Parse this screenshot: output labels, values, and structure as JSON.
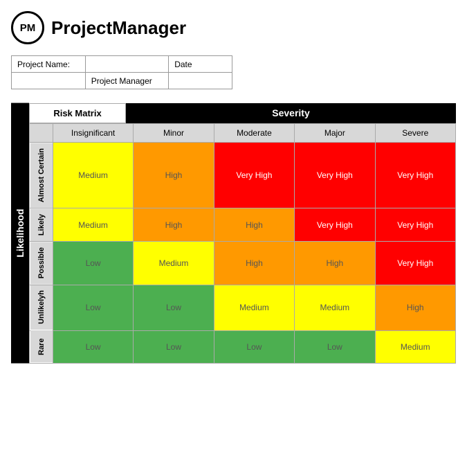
{
  "header": {
    "logo_text": "PM",
    "app_title": "ProjectManager"
  },
  "project_info": {
    "labels": [
      "Project Name:",
      "Project Manager",
      "Date"
    ],
    "values": [
      "",
      "",
      ""
    ]
  },
  "matrix": {
    "likelihood_label": "Likelihood",
    "severity_label": "Severity",
    "risk_matrix_label": "Risk Matrix",
    "col_headers": [
      "Insignificant",
      "Minor",
      "Moderate",
      "Major",
      "Severe"
    ],
    "rows": [
      {
        "label": "Almost Certain",
        "cells": [
          {
            "text": "Medium",
            "class": "medium"
          },
          {
            "text": "High",
            "class": "high"
          },
          {
            "text": "Very High",
            "class": "very-high"
          },
          {
            "text": "Very High",
            "class": "very-high"
          },
          {
            "text": "Very High",
            "class": "very-high"
          }
        ]
      },
      {
        "label": "Likely",
        "cells": [
          {
            "text": "Medium",
            "class": "medium"
          },
          {
            "text": "High",
            "class": "high"
          },
          {
            "text": "High",
            "class": "high"
          },
          {
            "text": "Very High",
            "class": "very-high"
          },
          {
            "text": "Very High",
            "class": "very-high"
          }
        ]
      },
      {
        "label": "Possible",
        "cells": [
          {
            "text": "Low",
            "class": "low"
          },
          {
            "text": "Medium",
            "class": "medium"
          },
          {
            "text": "High",
            "class": "high"
          },
          {
            "text": "High",
            "class": "high"
          },
          {
            "text": "Very High",
            "class": "very-high"
          }
        ]
      },
      {
        "label": "Unlikelyh",
        "cells": [
          {
            "text": "Low",
            "class": "low"
          },
          {
            "text": "Low",
            "class": "low"
          },
          {
            "text": "Medium",
            "class": "medium"
          },
          {
            "text": "Medium",
            "class": "medium"
          },
          {
            "text": "High",
            "class": "high"
          }
        ]
      },
      {
        "label": "Rare",
        "cells": [
          {
            "text": "Low",
            "class": "low"
          },
          {
            "text": "Low",
            "class": "low"
          },
          {
            "text": "Low",
            "class": "low"
          },
          {
            "text": "Low",
            "class": "low"
          },
          {
            "text": "Medium",
            "class": "medium"
          }
        ]
      }
    ]
  }
}
